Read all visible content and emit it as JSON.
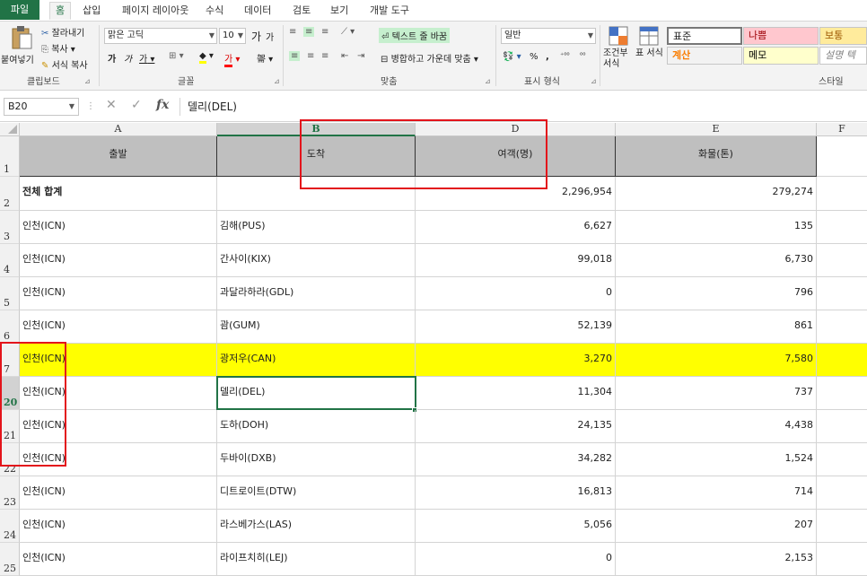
{
  "tabs": [
    "파일",
    "홈",
    "삽입",
    "페이지 레이아웃",
    "수식",
    "데이터",
    "검토",
    "보기",
    "개발 도구"
  ],
  "ribbon": {
    "paste": "붙여넣기",
    "cut": "잘라내기",
    "copy": "복사",
    "format_painter": "서식 복사",
    "clipboard_label": "클립보드",
    "font_name": "맑은 고딕",
    "font_size": "10",
    "font_grow": "가",
    "font_shrink": "가",
    "bold": "가",
    "italic": "가",
    "underline": "가",
    "font_label": "글꼴",
    "wrap_text": "텍스트 줄 바꿈",
    "merge_center": "병합하고 가운데 맞춤",
    "align_label": "맞춤",
    "number_format": "일반",
    "percent": "%",
    "comma": ",",
    "number_label": "표시 형식",
    "conditional_format": "조건부 서식",
    "table_format": "표 서식",
    "styles_label": "스타일",
    "styles": [
      {
        "name": "표준",
        "bg": "#ffffff",
        "color": "#000000"
      },
      {
        "name": "나쁨",
        "bg": "#ffc7ce",
        "color": "#9c0006"
      },
      {
        "name": "보통",
        "bg": "#ffeb9c",
        "color": "#9c5700"
      },
      {
        "name": "계산",
        "bg": "#f2f2f2",
        "color": "#fa7d00"
      },
      {
        "name": "메모",
        "bg": "#ffffcc",
        "color": "#000000"
      },
      {
        "name": "설명 텍",
        "bg": "#ffffff",
        "color": "#7f7f7f"
      }
    ]
  },
  "formula_bar": {
    "name_box": "B20",
    "formula": "델리(DEL)"
  },
  "columns": [
    "A",
    "B",
    "D",
    "E",
    "F"
  ],
  "header_row": {
    "row": "1",
    "a": "출발",
    "b": "도착",
    "d": "여객(명)",
    "e": "화물(톤)"
  },
  "rows": [
    {
      "row": "2",
      "a": "전체 합계",
      "b": "",
      "d": "2,296,954",
      "e": "279,274",
      "bold": true
    },
    {
      "row": "3",
      "a": "인천(ICN)",
      "b": "김해(PUS)",
      "d": "6,627",
      "e": "135"
    },
    {
      "row": "4",
      "a": "인천(ICN)",
      "b": "간사이(KIX)",
      "d": "99,018",
      "e": "6,730"
    },
    {
      "row": "5",
      "a": "인천(ICN)",
      "b": "과달라하라(GDL)",
      "d": "0",
      "e": "796"
    },
    {
      "row": "6",
      "a": "인천(ICN)",
      "b": "괌(GUM)",
      "d": "52,139",
      "e": "861"
    },
    {
      "row": "7",
      "a": "인천(ICN)",
      "b": "광저우(CAN)",
      "d": "3,270",
      "e": "7,580",
      "highlight": true
    },
    {
      "row": "20",
      "a": "인천(ICN)",
      "b": "델리(DEL)",
      "d": "11,304",
      "e": "737",
      "selected": true
    },
    {
      "row": "21",
      "a": "인천(ICN)",
      "b": "도하(DOH)",
      "d": "24,135",
      "e": "4,438"
    },
    {
      "row": "22",
      "a": "인천(ICN)",
      "b": "두바이(DXB)",
      "d": "34,282",
      "e": "1,524"
    },
    {
      "row": "23",
      "a": "인천(ICN)",
      "b": "디트로이트(DTW)",
      "d": "16,813",
      "e": "714"
    },
    {
      "row": "24",
      "a": "인천(ICN)",
      "b": "라스베가스(LAS)",
      "d": "5,056",
      "e": "207"
    },
    {
      "row": "25",
      "a": "인천(ICN)",
      "b": "라이프치히(LEJ)",
      "d": "0",
      "e": "2,153"
    }
  ],
  "colors": {
    "highlight": "#ffff00",
    "header_bg": "#bfbfbf",
    "accent": "#217346",
    "annotation": "#e3141b"
  }
}
